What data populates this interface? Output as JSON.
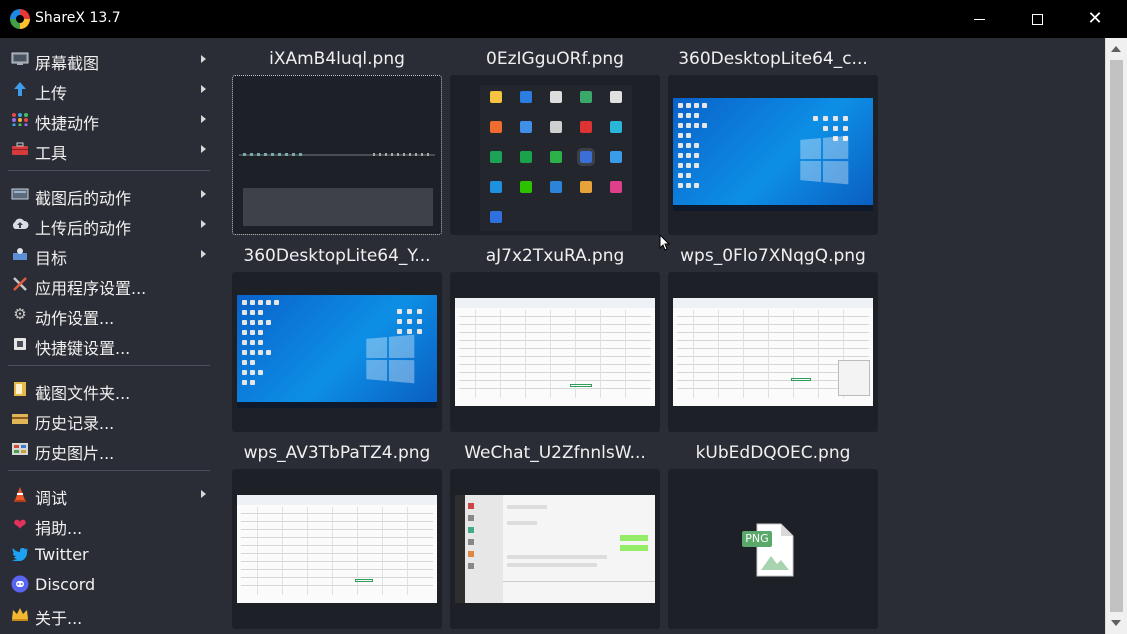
{
  "window": {
    "title": "ShareX 13.7"
  },
  "menu": {
    "group1": [
      {
        "label": "屏幕截图",
        "icon": "monitor-capture-icon"
      },
      {
        "label": "上传",
        "icon": "upload-arrow-icon"
      },
      {
        "label": "快捷动作",
        "icon": "dots-grid-icon"
      },
      {
        "label": "工具",
        "icon": "toolbox-icon"
      }
    ],
    "group2": [
      {
        "label": "截图后的动作",
        "icon": "after-capture-icon"
      },
      {
        "label": "上传后的动作",
        "icon": "cloud-upload-icon"
      },
      {
        "label": "目标",
        "icon": "destination-icon"
      },
      {
        "label": "应用程序设置...",
        "icon": "wrench-screwdriver-icon"
      },
      {
        "label": "动作设置...",
        "icon": "gear-icon"
      },
      {
        "label": "快捷键设置...",
        "icon": "keyboard-icon"
      }
    ],
    "group3": [
      {
        "label": "截图文件夹...",
        "icon": "folder-icon"
      },
      {
        "label": "历史记录...",
        "icon": "history-icon"
      },
      {
        "label": "历史图片...",
        "icon": "image-history-icon"
      }
    ],
    "group4": [
      {
        "label": "调试",
        "icon": "traffic-cone-icon"
      },
      {
        "label": "捐助...",
        "icon": "heart-icon"
      },
      {
        "label": "Twitter",
        "icon": "twitter-bird-icon"
      },
      {
        "label": "Discord",
        "icon": "discord-icon"
      },
      {
        "label": "关于...",
        "icon": "crown-icon"
      }
    ]
  },
  "thumbnails": [
    {
      "name": "iXAmB4luql.png",
      "kind": "dark-strip",
      "selected": true
    },
    {
      "name": "0EzIGguORf.png",
      "kind": "tray-icons"
    },
    {
      "name": "360DesktopLite64_c...",
      "kind": "desktop"
    },
    {
      "name": "360DesktopLite64_Y...",
      "kind": "desktop"
    },
    {
      "name": "aJ7x2TxuRA.png",
      "kind": "spreadsheet"
    },
    {
      "name": "wps_0Flo7XNqgQ.png",
      "kind": "spreadsheet"
    },
    {
      "name": "wps_AV3TbPaTZ4.png",
      "kind": "spreadsheet"
    },
    {
      "name": "WeChat_U2ZfnnlsW...",
      "kind": "chat"
    },
    {
      "name": "kUbEdDQOEC.png",
      "kind": "png-file-icon",
      "file_badge": "PNG"
    }
  ],
  "colors": {
    "background": "#2a2d35",
    "thumbnail_bg": "#1d2027",
    "titlebar": "#000000",
    "text": "#f0f0f0"
  }
}
